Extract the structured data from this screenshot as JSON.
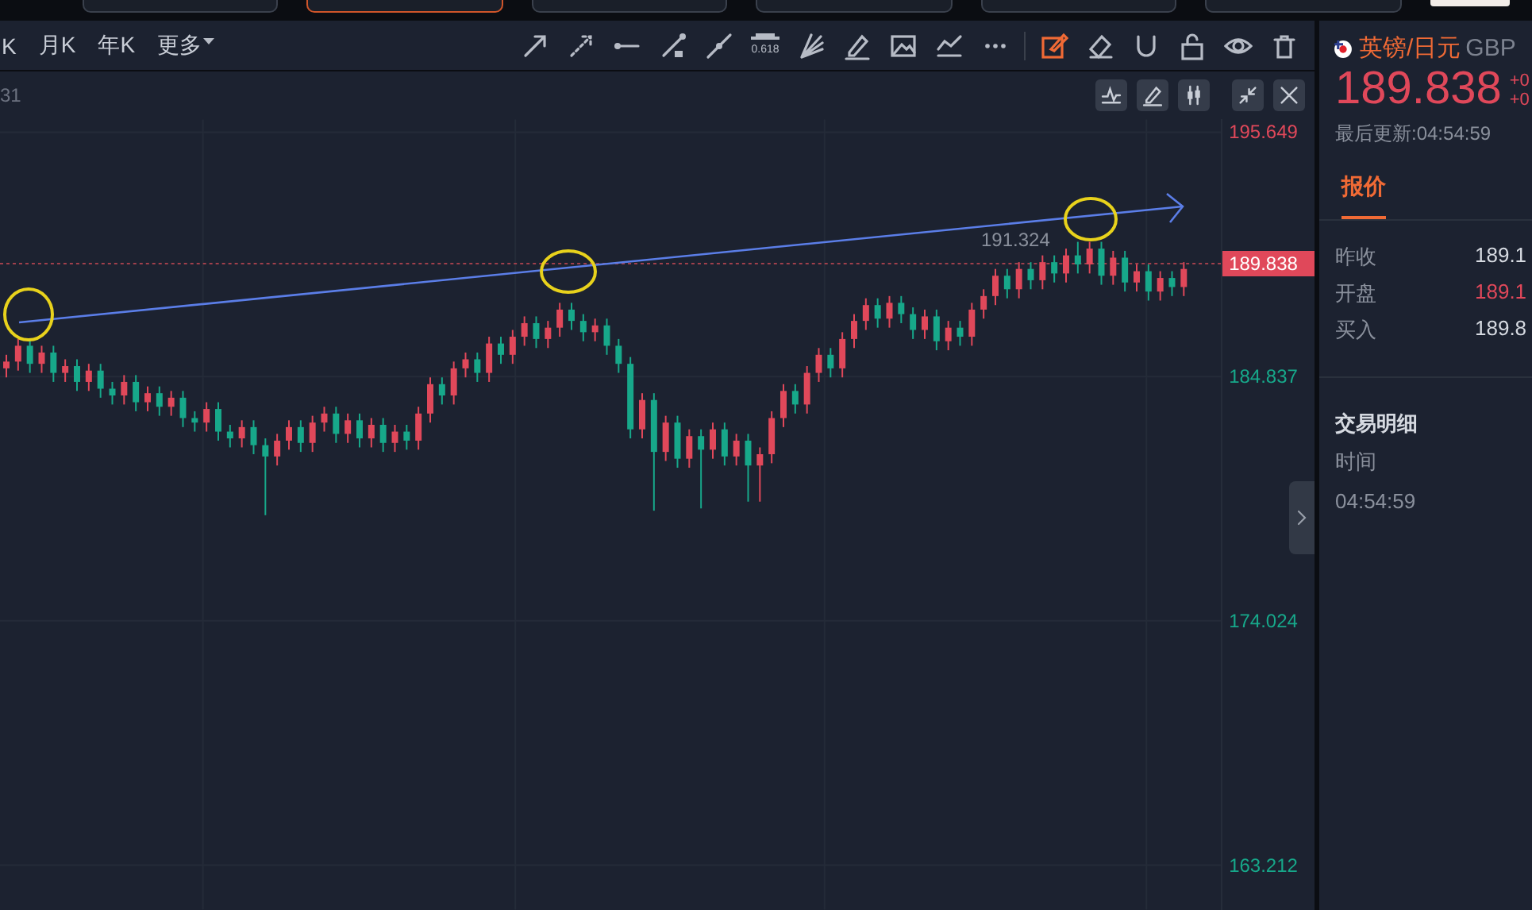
{
  "top_tabs": [
    {
      "selected": false
    },
    {
      "selected": true
    },
    {
      "selected": false
    },
    {
      "selected": false
    },
    {
      "selected": false
    },
    {
      "selected": false
    }
  ],
  "periods": [
    {
      "label": "K"
    },
    {
      "label": "月K"
    },
    {
      "label": "年K"
    },
    {
      "label": "更多",
      "kind": "dropdown"
    }
  ],
  "tools": [
    {
      "kind": "arrow",
      "selected": false
    },
    {
      "kind": "dashed-arrow",
      "selected": false
    },
    {
      "kind": "ray",
      "selected": false
    },
    {
      "kind": "segment",
      "selected": false
    },
    {
      "kind": "line",
      "selected": false
    },
    {
      "kind": "fib",
      "label": "0.618",
      "selected": false
    },
    {
      "kind": "fan",
      "selected": false
    },
    {
      "kind": "pen",
      "selected": false
    },
    {
      "kind": "image",
      "selected": false
    },
    {
      "kind": "trend",
      "selected": false
    },
    {
      "kind": "more",
      "selected": false
    },
    {
      "kind": "separator"
    },
    {
      "kind": "edit",
      "selected": true
    },
    {
      "kind": "eraser",
      "selected": false
    },
    {
      "kind": "magnet",
      "selected": false
    },
    {
      "kind": "lock",
      "selected": false
    },
    {
      "kind": "eye",
      "selected": false
    },
    {
      "kind": "trash",
      "selected": false
    }
  ],
  "chart": {
    "header": "31",
    "buttons": [
      {
        "kind": "indicator"
      },
      {
        "kind": "pen"
      },
      {
        "kind": "candles"
      },
      {
        "kind": "shrink"
      },
      {
        "kind": "close"
      }
    ],
    "chart_data": {
      "type": "candlestick",
      "ylim": [
        163.212,
        195.649
      ],
      "ref_lines": [
        {
          "axis": "y",
          "value": 189.838,
          "label": "189.838"
        }
      ],
      "annotations": [
        "191.324"
      ],
      "yticks": [
        {
          "value": 195.649,
          "label": "195.649"
        },
        {
          "value": 184.837,
          "label": "184.837"
        },
        {
          "value": 174.024,
          "label": "174.024"
        },
        {
          "value": 163.212,
          "label": "163.212"
        }
      ],
      "categories": [
        null,
        null,
        null,
        null,
        null,
        null,
        null,
        null,
        null,
        null,
        null,
        null,
        null,
        null,
        null,
        null,
        null,
        null,
        null,
        null,
        null,
        null,
        null,
        null,
        null,
        null,
        null,
        null,
        null,
        null,
        null,
        null,
        null,
        null,
        null,
        null,
        null,
        null,
        null,
        null,
        null,
        null,
        null,
        null,
        null,
        null,
        null,
        null,
        null,
        null,
        null,
        null,
        null,
        null,
        null,
        null,
        null,
        null,
        null,
        null,
        null,
        null,
        null,
        null,
        null,
        null,
        null,
        null,
        null,
        null,
        null,
        null,
        null,
        null,
        null,
        null,
        null,
        null,
        null,
        null,
        null,
        null,
        null,
        null,
        null,
        null,
        null,
        null,
        null,
        null,
        null,
        null,
        null,
        null,
        null,
        null,
        null,
        null,
        null,
        null,
        null
      ],
      "ohlc": [
        [
          185.2,
          185.8,
          184.8,
          185.5
        ],
        [
          185.5,
          186.5,
          185.1,
          186.2
        ],
        [
          186.2,
          186.5,
          185.0,
          185.4
        ],
        [
          185.4,
          186.2,
          185.0,
          185.9
        ],
        [
          185.9,
          186.2,
          184.6,
          185.0
        ],
        [
          185.0,
          185.6,
          184.6,
          185.3
        ],
        [
          185.3,
          185.6,
          184.2,
          184.6
        ],
        [
          184.6,
          185.4,
          184.2,
          185.1
        ],
        [
          185.1,
          185.4,
          183.9,
          184.3
        ],
        [
          184.3,
          184.6,
          183.6,
          184.0
        ],
        [
          184.0,
          184.9,
          183.6,
          184.6
        ],
        [
          184.6,
          184.9,
          183.3,
          183.7
        ],
        [
          183.7,
          184.4,
          183.3,
          184.1
        ],
        [
          184.1,
          184.4,
          183.1,
          183.5
        ],
        [
          183.5,
          184.2,
          183.1,
          183.9
        ],
        [
          183.9,
          184.2,
          182.6,
          183.0
        ],
        [
          183.0,
          183.3,
          182.4,
          182.8
        ],
        [
          182.8,
          183.7,
          182.4,
          183.4
        ],
        [
          183.4,
          183.7,
          182.0,
          182.4
        ],
        [
          182.4,
          182.7,
          181.7,
          182.1
        ],
        [
          182.1,
          182.9,
          181.7,
          182.6
        ],
        [
          182.6,
          182.9,
          181.4,
          181.8
        ],
        [
          181.8,
          182.1,
          178.7,
          181.3
        ],
        [
          181.3,
          182.3,
          180.9,
          182.0
        ],
        [
          182.0,
          182.9,
          181.6,
          182.6
        ],
        [
          182.6,
          182.9,
          181.5,
          181.9
        ],
        [
          181.9,
          183.1,
          181.5,
          182.8
        ],
        [
          182.8,
          183.5,
          182.4,
          183.2
        ],
        [
          183.2,
          183.5,
          181.9,
          182.3
        ],
        [
          182.3,
          183.2,
          181.9,
          182.9
        ],
        [
          182.9,
          183.2,
          181.7,
          182.1
        ],
        [
          182.1,
          183.0,
          181.7,
          182.7
        ],
        [
          182.7,
          183.0,
          181.5,
          181.9
        ],
        [
          181.9,
          182.7,
          181.5,
          182.4
        ],
        [
          182.4,
          182.7,
          181.6,
          182.0
        ],
        [
          182.0,
          183.5,
          181.6,
          183.2
        ],
        [
          183.2,
          184.8,
          182.8,
          184.5
        ],
        [
          184.5,
          184.8,
          183.6,
          184.0
        ],
        [
          184.0,
          185.5,
          183.6,
          185.2
        ],
        [
          185.2,
          185.9,
          184.8,
          185.6
        ],
        [
          185.6,
          185.9,
          184.6,
          185.0
        ],
        [
          185.0,
          186.6,
          184.6,
          186.3
        ],
        [
          186.3,
          186.6,
          185.4,
          185.8
        ],
        [
          185.8,
          186.9,
          185.4,
          186.6
        ],
        [
          186.6,
          187.5,
          186.2,
          187.2
        ],
        [
          187.2,
          187.5,
          186.1,
          186.5
        ],
        [
          186.5,
          187.3,
          186.1,
          187.0
        ],
        [
          187.0,
          188.1,
          186.6,
          187.8
        ],
        [
          187.8,
          188.1,
          186.9,
          187.3
        ],
        [
          187.3,
          187.6,
          186.4,
          186.8
        ],
        [
          186.8,
          187.4,
          186.4,
          187.1
        ],
        [
          187.1,
          187.4,
          185.8,
          186.2
        ],
        [
          186.2,
          186.5,
          185.0,
          185.4
        ],
        [
          185.4,
          185.7,
          182.1,
          182.5
        ],
        [
          182.5,
          184.1,
          182.1,
          183.8
        ],
        [
          183.8,
          184.1,
          178.9,
          181.5
        ],
        [
          181.5,
          183.1,
          181.1,
          182.8
        ],
        [
          182.8,
          183.1,
          180.8,
          181.2
        ],
        [
          181.2,
          182.5,
          180.8,
          182.2
        ],
        [
          182.2,
          182.5,
          179.0,
          181.6
        ],
        [
          181.6,
          182.8,
          181.2,
          182.5
        ],
        [
          182.5,
          182.8,
          180.9,
          181.3
        ],
        [
          181.3,
          182.3,
          180.9,
          182.0
        ],
        [
          182.0,
          182.3,
          179.3,
          180.9
        ],
        [
          180.9,
          181.7,
          179.3,
          181.4
        ],
        [
          181.4,
          183.3,
          181.0,
          183.0
        ],
        [
          183.0,
          184.5,
          182.6,
          184.2
        ],
        [
          184.2,
          184.5,
          183.2,
          183.6
        ],
        [
          183.6,
          185.3,
          183.2,
          185.0
        ],
        [
          185.0,
          186.1,
          184.6,
          185.8
        ],
        [
          185.8,
          186.1,
          184.8,
          185.2
        ],
        [
          185.2,
          186.8,
          184.8,
          186.5
        ],
        [
          186.5,
          187.6,
          186.1,
          187.3
        ],
        [
          187.3,
          188.3,
          186.9,
          188.0
        ],
        [
          188.0,
          188.3,
          187.0,
          187.4
        ],
        [
          187.4,
          188.4,
          187.0,
          188.1
        ],
        [
          188.1,
          188.4,
          187.2,
          187.6
        ],
        [
          187.6,
          187.9,
          186.5,
          186.9
        ],
        [
          186.9,
          187.8,
          186.5,
          187.5
        ],
        [
          187.5,
          187.8,
          186.0,
          186.4
        ],
        [
          186.4,
          187.3,
          186.0,
          187.0
        ],
        [
          187.0,
          187.3,
          186.2,
          186.6
        ],
        [
          186.6,
          188.1,
          186.2,
          187.8
        ],
        [
          187.8,
          188.7,
          187.4,
          188.4
        ],
        [
          188.4,
          189.6,
          188.0,
          189.3
        ],
        [
          189.3,
          189.6,
          188.3,
          188.7
        ],
        [
          188.7,
          189.9,
          188.3,
          189.6
        ],
        [
          189.6,
          189.9,
          188.7,
          189.1
        ],
        [
          189.1,
          190.2,
          188.7,
          189.9
        ],
        [
          189.9,
          190.2,
          189.0,
          189.4
        ],
        [
          189.4,
          190.5,
          189.0,
          190.2
        ],
        [
          190.2,
          190.8,
          189.4,
          189.8
        ],
        [
          189.8,
          190.8,
          189.4,
          190.5
        ],
        [
          190.5,
          190.8,
          188.9,
          189.3
        ],
        [
          189.3,
          190.4,
          188.9,
          190.1
        ],
        [
          190.1,
          190.4,
          188.6,
          189.0
        ],
        [
          189.0,
          189.8,
          188.6,
          189.5
        ],
        [
          189.5,
          189.8,
          188.2,
          188.6
        ],
        [
          188.6,
          189.5,
          188.2,
          189.2
        ],
        [
          189.2,
          189.5,
          188.4,
          188.8
        ],
        [
          188.8,
          189.9,
          188.4,
          189.6
        ]
      ]
    }
  },
  "quote": {
    "name": "英镑/日元",
    "code": "GBP",
    "price": "189.838",
    "changes": [
      "+0",
      "+0"
    ],
    "updated": "最后更新:04:54:59",
    "tabs": [
      {
        "label": "报价",
        "selected": true
      }
    ],
    "rows": [
      {
        "label": "昨收",
        "value": "189.1",
        "kind": "neutral"
      },
      {
        "label": "开盘",
        "value": "189.1",
        "kind": "up"
      },
      {
        "label": "买入",
        "value": "189.8",
        "kind": "neutral"
      }
    ],
    "trades_title": "交易明细",
    "trades_header": "时间",
    "trades": [
      "04:54:59"
    ]
  }
}
